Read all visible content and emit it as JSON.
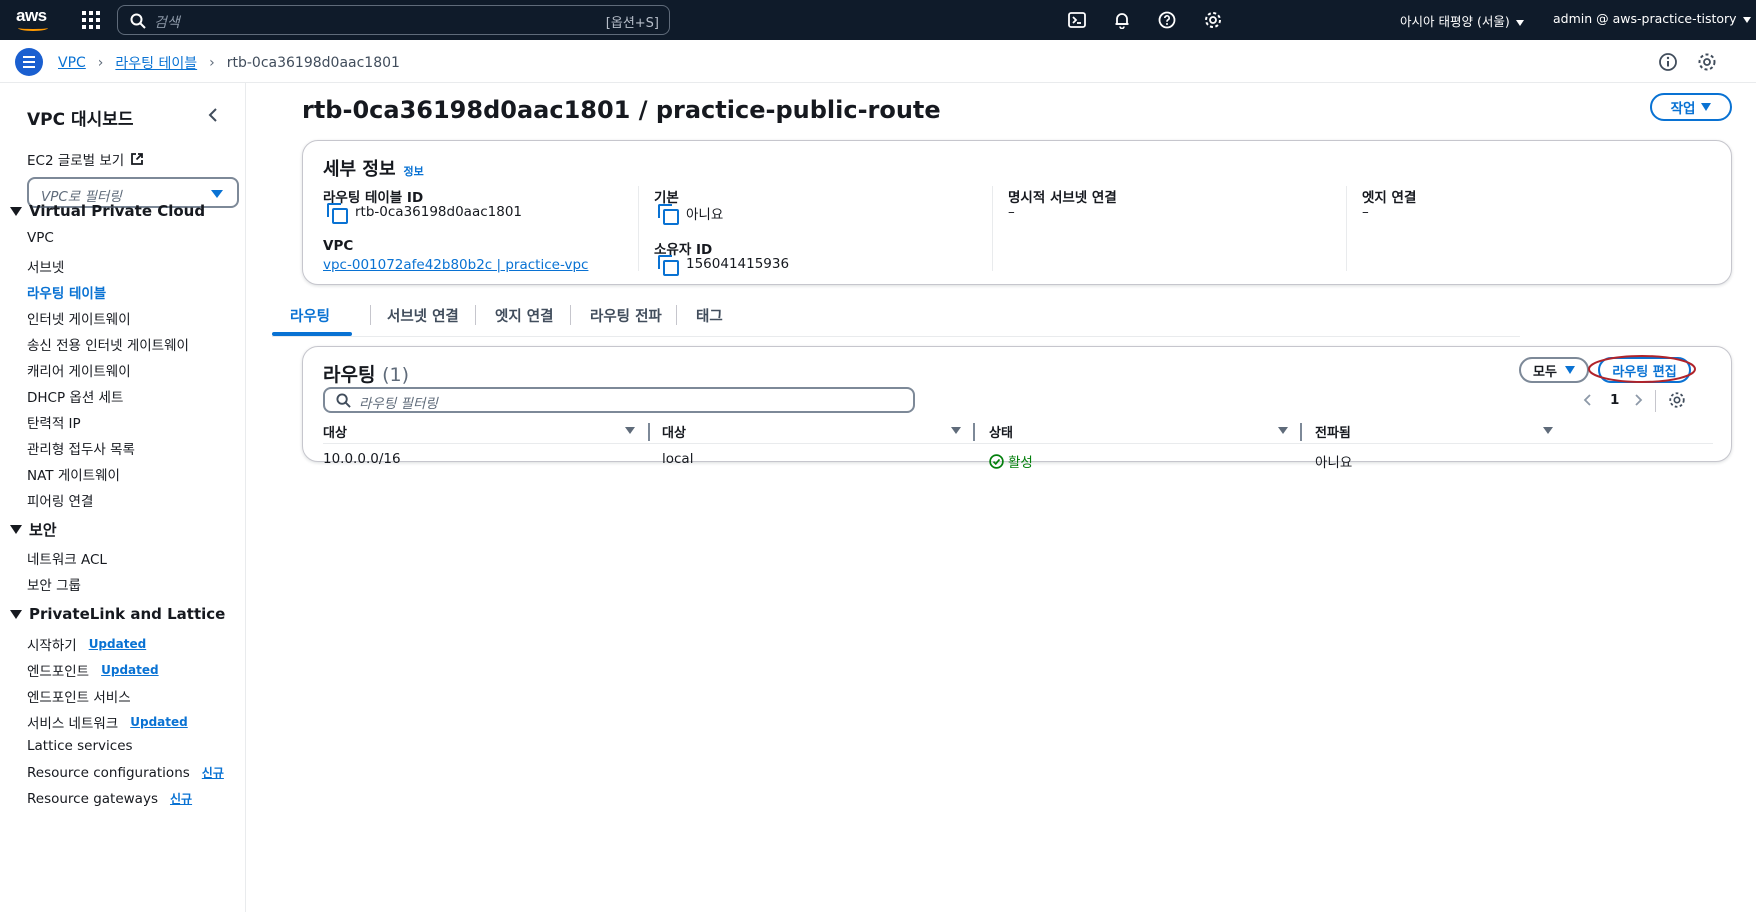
{
  "topnav": {
    "logo": "aws",
    "search_placeholder": "검색",
    "search_shortcut": "[옵션+S]",
    "region": "아시아 태평양 (서울)",
    "account": "admin @ aws-practice-tistory",
    "icons": [
      "grid-icon",
      "search-icon",
      "cloudshell-icon",
      "bell-icon",
      "help-icon",
      "gear-icon"
    ]
  },
  "breadcrumb": {
    "items": [
      "VPC",
      "라우팅 테이블"
    ],
    "current": "rtb-0ca36198d0aac1801"
  },
  "sidebar": {
    "title": "VPC 대시보드",
    "ec2_link": "EC2 글로벌 보기",
    "filter_placeholder": "VPC로 필터링",
    "sections": [
      {
        "title": "Virtual Private Cloud",
        "items": [
          "VPC",
          "서브넷",
          "라우팅 테이블",
          "인터넷 게이트웨이",
          "송신 전용 인터넷 게이트웨이",
          "캐리어 게이트웨이",
          "DHCP 옵션 세트",
          "탄력적 IP",
          "관리형 접두사 목록",
          "NAT 게이트웨이",
          "피어링 연결"
        ]
      },
      {
        "title": "보안",
        "items": [
          "네트워크 ACL",
          "보안 그룹"
        ]
      },
      {
        "title": "PrivateLink and Lattice",
        "items": [
          {
            "label": "시작하기",
            "badge": "Updated"
          },
          {
            "label": "엔드포인트",
            "badge": "Updated"
          },
          {
            "label": "엔드포인트 서비스",
            "badge": ""
          },
          {
            "label": "서비스 네트워크",
            "badge": "Updated"
          },
          {
            "label": "Lattice services",
            "badge": ""
          },
          {
            "label": "Resource configurations",
            "badge": "신규"
          },
          {
            "label": "Resource gateways",
            "badge": "신규"
          }
        ]
      }
    ],
    "active_item": "라우팅 테이블"
  },
  "page": {
    "title": "rtb-0ca36198d0aac1801 / practice-public-route",
    "actions_label": "작업"
  },
  "details": {
    "heading": "세부 정보",
    "info": "정보",
    "route_table_id_label": "라우팅 테이블 ID",
    "route_table_id": "rtb-0ca36198d0aac1801",
    "main_label": "기본",
    "main_value": "아니요",
    "explicit_subnet_label": "명시적 서브넷 연결",
    "explicit_subnet_value": "–",
    "edge_label": "엣지 연결",
    "edge_value": "–",
    "vpc_label": "VPC",
    "vpc_value": "vpc-001072afe42b80b2c | practice-vpc",
    "owner_label": "소유자 ID",
    "owner_value": "156041415936"
  },
  "tabs": [
    "라우팅",
    "서브넷 연결",
    "엣지 연결",
    "라우팅 전파",
    "태그"
  ],
  "routes": {
    "heading": "라우팅",
    "count": "(1)",
    "filter_placeholder": "라우팅 필터링",
    "dropdown_label": "모두",
    "edit_label": "라우팅 편집",
    "page": "1",
    "columns": [
      "대상",
      "대상",
      "상태",
      "전파됨"
    ],
    "rows": [
      {
        "destination": "10.0.0.0/16",
        "target": "local",
        "status": "활성",
        "propagated": "아니요"
      }
    ]
  },
  "colors": {
    "accent": "#0972d3",
    "nav_bg": "#0f1b2a",
    "success": "#037f0c",
    "highlight_circle": "#b0232a"
  }
}
